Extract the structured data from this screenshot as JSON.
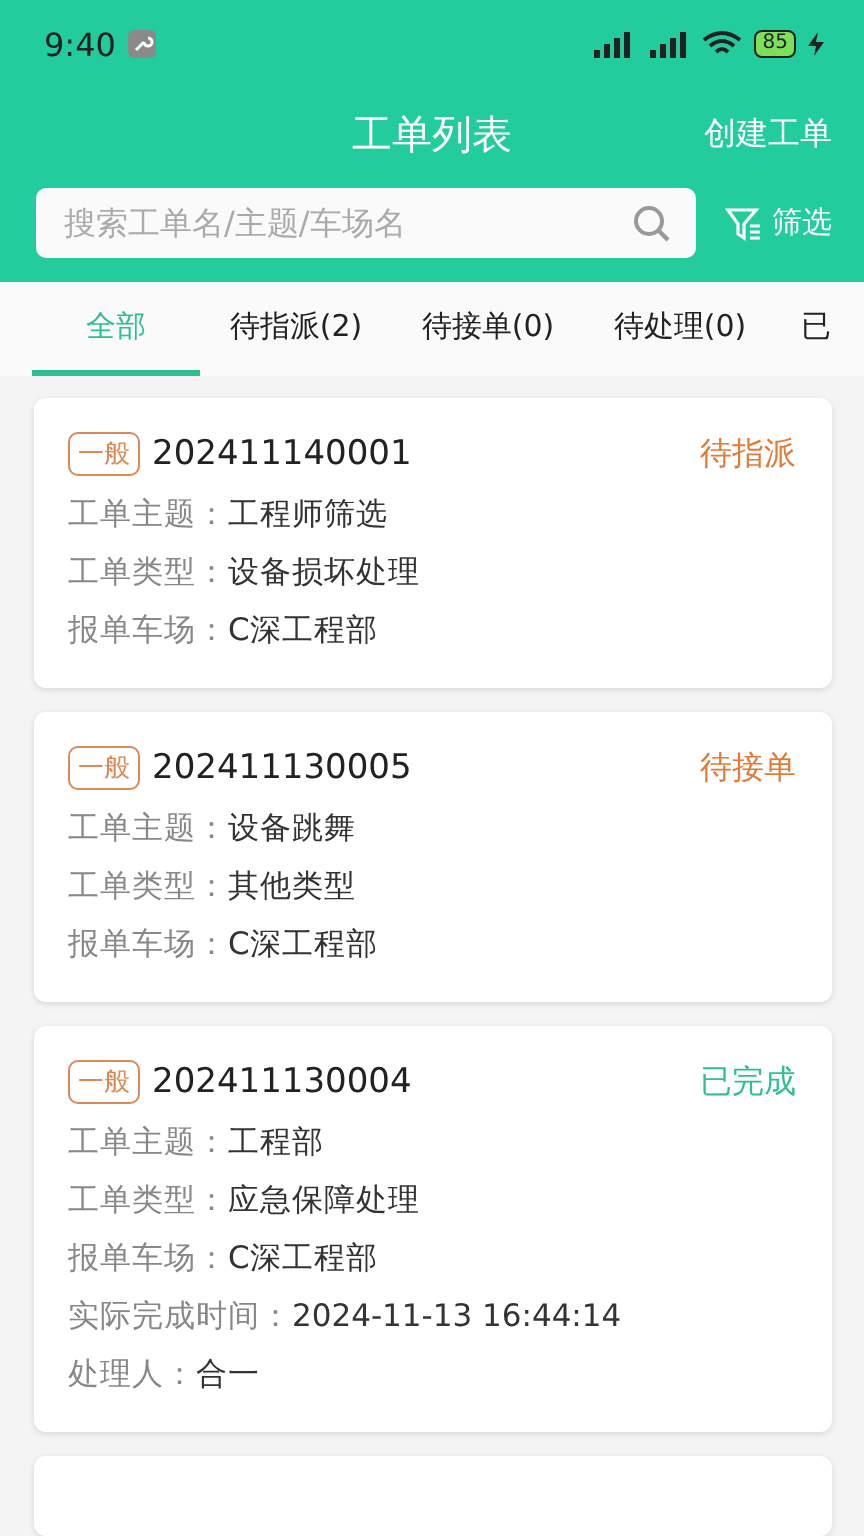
{
  "status_bar": {
    "time": "9:40",
    "battery": "85"
  },
  "header": {
    "title": "工单列表",
    "action": "创建工单"
  },
  "search": {
    "placeholder": "搜索工单名/主题/车场名",
    "filter": "筛选"
  },
  "tabs": [
    {
      "label": "全部",
      "selected": true
    },
    {
      "label": "待指派(2)",
      "selected": false
    },
    {
      "label": "待接单(0)",
      "selected": false
    },
    {
      "label": "待处理(0)",
      "selected": false
    },
    {
      "label": "已",
      "selected": false
    }
  ],
  "orders": [
    {
      "badge": "一般",
      "number": "202411140001",
      "status": "待指派",
      "color": "#e07b39",
      "fields": [
        {
          "label": "工单主题：",
          "value": "工程师筛选"
        },
        {
          "label": "工单类型：",
          "value": "设备损坏处理"
        },
        {
          "label": "报单车场：",
          "value": "C深工程部"
        }
      ]
    },
    {
      "badge": "一般",
      "number": "202411130005",
      "status": "待接单",
      "color": "#e07b39",
      "fields": [
        {
          "label": "工单主题：",
          "value": "设备跳舞"
        },
        {
          "label": "工单类型：",
          "value": "其他类型"
        },
        {
          "label": "报单车场：",
          "value": "C深工程部"
        }
      ]
    },
    {
      "badge": "一般",
      "number": "202411130004",
      "status": "已完成",
      "color": "#2fbf93",
      "fields": [
        {
          "label": "工单主题：",
          "value": "工程部"
        },
        {
          "label": "工单类型：",
          "value": "应急保障处理"
        },
        {
          "label": "报单车场：",
          "value": "C深工程部"
        },
        {
          "label": "实际完成时间：",
          "value": "2024-11-13 16:44:14"
        },
        {
          "label": "处理人：",
          "value": "合一"
        }
      ]
    }
  ]
}
